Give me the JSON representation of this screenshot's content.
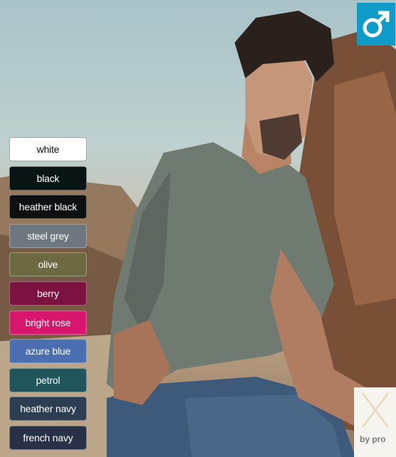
{
  "colors": {
    "badge": "#0e9bc7"
  },
  "badge": {
    "icon": "male-symbol-icon"
  },
  "swatches": [
    {
      "label": "white",
      "color": "#ffffff"
    },
    {
      "label": "black",
      "color": "#0b1414"
    },
    {
      "label": "heather black",
      "color": "#0d0f10"
    },
    {
      "label": "steel grey",
      "color": "#6e7680"
    },
    {
      "label": "olive",
      "color": "#6d6a43"
    },
    {
      "label": "berry",
      "color": "#7b1240"
    },
    {
      "label": "bright rose",
      "color": "#d8166e"
    },
    {
      "label": "azure blue",
      "color": "#4a6eaf"
    },
    {
      "label": "petrol",
      "color": "#1f555b"
    },
    {
      "label": "heather navy",
      "color": "#2d3d52"
    },
    {
      "label": "french navy",
      "color": "#283147"
    }
  ],
  "brand": {
    "text": "by pro"
  }
}
